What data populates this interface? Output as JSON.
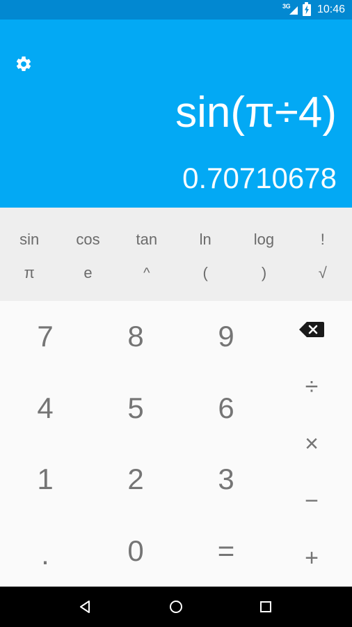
{
  "status_bar": {
    "network_label": "3G",
    "network_icon": "signal-3g-icon",
    "battery_icon": "battery-charging-icon",
    "time": "10:46",
    "background_color": "#0288D1"
  },
  "display": {
    "settings_icon": "gear-icon",
    "formula": "sin(π÷4)",
    "result": "0.70710678",
    "background_color": "#03A9F4",
    "text_color": "#FFFFFF"
  },
  "sci_pad": {
    "background_color": "#EEEEEE",
    "text_color": "#6B6B6B",
    "rows": [
      [
        {
          "label": "sin",
          "name": "sin-key"
        },
        {
          "label": "cos",
          "name": "cos-key"
        },
        {
          "label": "tan",
          "name": "tan-key"
        },
        {
          "label": "ln",
          "name": "ln-key"
        },
        {
          "label": "log",
          "name": "log-key"
        },
        {
          "label": "!",
          "name": "factorial-key"
        }
      ],
      [
        {
          "label": "π",
          "name": "pi-key"
        },
        {
          "label": "e",
          "name": "e-key"
        },
        {
          "label": "^",
          "name": "power-key"
        },
        {
          "label": "(",
          "name": "open-paren-key"
        },
        {
          "label": ")",
          "name": "close-paren-key"
        },
        {
          "label": "√",
          "name": "sqrt-key"
        }
      ]
    ]
  },
  "num_pad": {
    "background_color": "#FAFAFA",
    "text_color": "#757575",
    "digits": [
      {
        "label": "7",
        "name": "digit-7-key"
      },
      {
        "label": "8",
        "name": "digit-8-key"
      },
      {
        "label": "9",
        "name": "digit-9-key"
      },
      {
        "label": "4",
        "name": "digit-4-key"
      },
      {
        "label": "5",
        "name": "digit-5-key"
      },
      {
        "label": "6",
        "name": "digit-6-key"
      },
      {
        "label": "1",
        "name": "digit-1-key"
      },
      {
        "label": "2",
        "name": "digit-2-key"
      },
      {
        "label": "3",
        "name": "digit-3-key"
      },
      {
        "label": ".",
        "name": "decimal-point-key"
      },
      {
        "label": "0",
        "name": "digit-0-key"
      },
      {
        "label": "=",
        "name": "equals-key"
      }
    ],
    "operators": [
      {
        "label": "",
        "name": "backspace-key",
        "icon": "backspace-icon"
      },
      {
        "label": "÷",
        "name": "divide-key"
      },
      {
        "label": "×",
        "name": "multiply-key"
      },
      {
        "label": "−",
        "name": "subtract-key"
      },
      {
        "label": "+",
        "name": "add-key"
      }
    ]
  },
  "nav_bar": {
    "background_color": "#000000",
    "back_icon": "back-triangle-icon",
    "home_icon": "home-circle-icon",
    "recents_icon": "recents-square-icon"
  }
}
